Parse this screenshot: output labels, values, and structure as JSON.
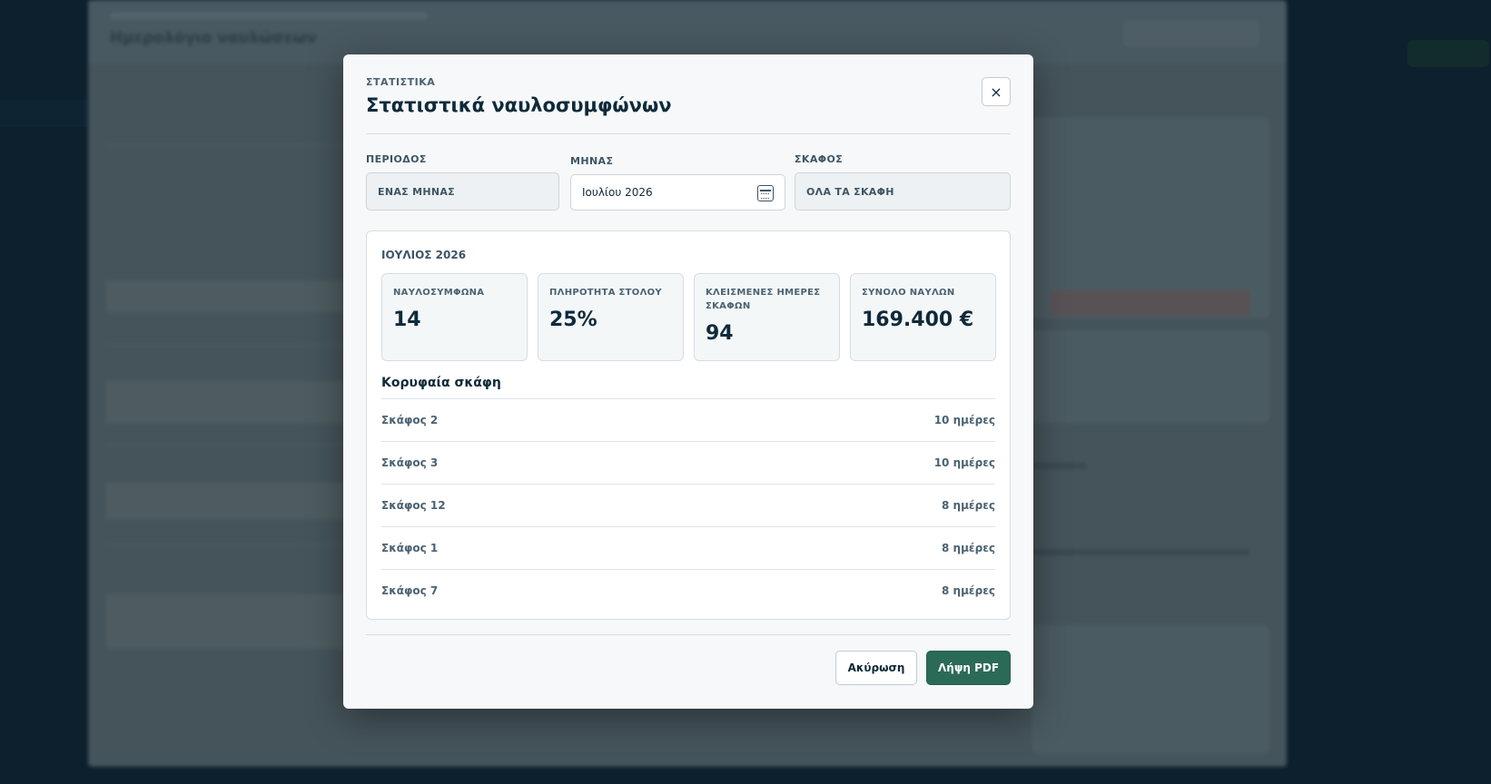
{
  "modal": {
    "eyebrow": "ΣΤΑΤΙΣΤΙΚΑ",
    "title": "Στατιστικά ναυλοσυμφώνων",
    "close_glyph": "×"
  },
  "filters": {
    "period": {
      "label": "ΠΕΡΙΟΔΟΣ",
      "value": "ΕΝΑΣ ΜΗΝΑΣ"
    },
    "month": {
      "label": "ΜΗΝΑΣ",
      "value": "Ιουλίου 2026",
      "icon": "calendar-icon"
    },
    "vessel": {
      "label": "ΣΚΑΦΟΣ",
      "value": "ΟΛΑ ΤΑ ΣΚΑΦΗ"
    }
  },
  "stats": {
    "heading": "ΙΟΥΛΙΟΣ 2026",
    "kpis": [
      {
        "label": "ΝΑΥΛΟΣΥΜΦΩΝΑ",
        "value": "14"
      },
      {
        "label": "ΠΛΗΡΟΤΗΤΑ ΣΤΟΛΟΥ",
        "value": "25%"
      },
      {
        "label": "ΚΛΕΙΣΜΕΝΕΣ ΗΜΕΡΕΣ ΣΚΑΦΩΝ",
        "value": "94"
      },
      {
        "label": "ΣΥΝΟΛΟ ΝΑΥΛΩΝ",
        "value": "169.400 €"
      }
    ],
    "top_vessels_title": "Κορυφαία σκάφη",
    "top_vessels": [
      {
        "name": "Σκάφος 2",
        "days": "10 ημέρες"
      },
      {
        "name": "Σκάφος 3",
        "days": "10 ημέρες"
      },
      {
        "name": "Σκάφος 12",
        "days": "8 ημέρες"
      },
      {
        "name": "Σκάφος 1",
        "days": "8 ημέρες"
      },
      {
        "name": "Σκάφος 7",
        "days": "8 ημέρες"
      }
    ]
  },
  "actions": {
    "cancel": "Ακύρωση",
    "download_pdf": "Λήψη PDF"
  },
  "background": {
    "title": "Ημερολόγιο ναυλώσεων"
  },
  "colors": {
    "primary": "#2b6a57",
    "text_dark": "#0f2a3a",
    "text_muted": "#4b6272"
  }
}
